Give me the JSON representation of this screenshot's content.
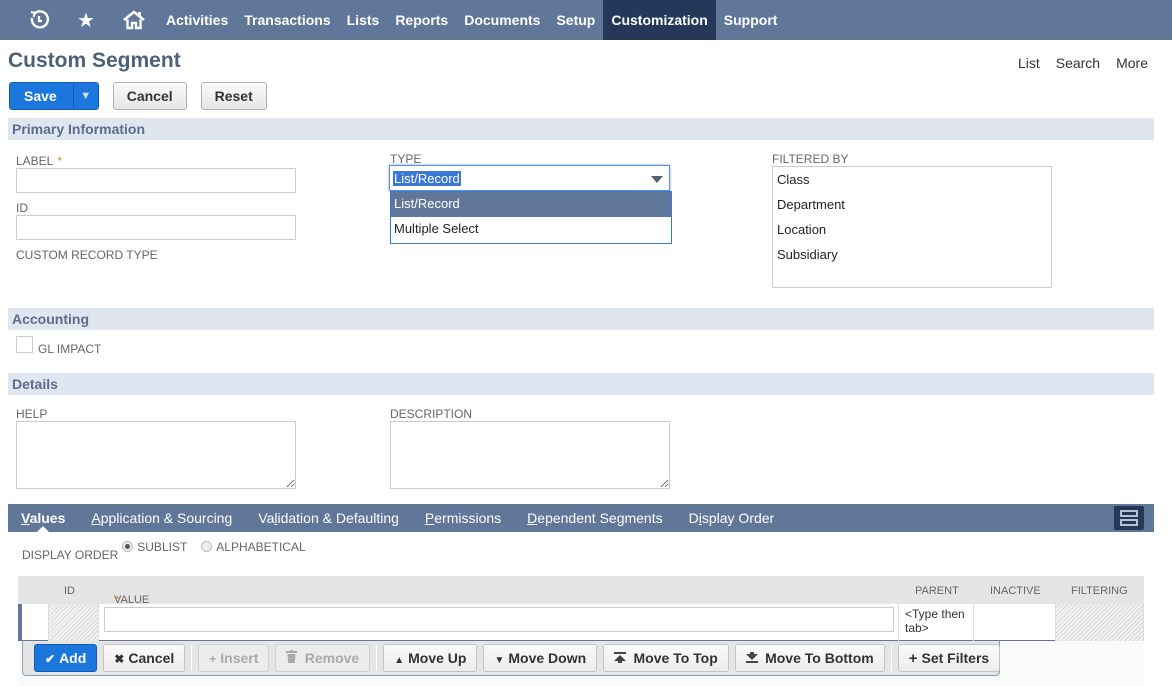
{
  "nav": {
    "icons": [
      "recent-icon",
      "star-icon",
      "home-icon"
    ],
    "items": [
      "Activities",
      "Transactions",
      "Lists",
      "Reports",
      "Documents",
      "Setup",
      "Customization",
      "Support"
    ],
    "active": "Customization"
  },
  "page": {
    "title": "Custom Segment",
    "links": [
      "List",
      "Search",
      "More"
    ]
  },
  "actions": {
    "save": "Save",
    "cancel": "Cancel",
    "reset": "Reset"
  },
  "primary": {
    "header": "Primary Information",
    "label_label": "LABEL",
    "label_required": "*",
    "label_value": "",
    "id_label": "ID",
    "id_value": "",
    "custom_record_type_label": "CUSTOM RECORD TYPE",
    "type_label": "TYPE",
    "type_value": "List/Record",
    "type_options": [
      "List/Record",
      "Multiple Select"
    ],
    "filtered_by_label": "FILTERED BY",
    "filtered_by_options": [
      "Class",
      "Department",
      "Location",
      "Subsidiary"
    ]
  },
  "accounting": {
    "header": "Accounting",
    "gl_impact_label": "GL IMPACT",
    "gl_impact_checked": false
  },
  "details": {
    "header": "Details",
    "help_label": "HELP",
    "help_value": "",
    "description_label": "DESCRIPTION",
    "description_value": ""
  },
  "subtabs": {
    "items": [
      {
        "label": "Values",
        "accesskey_index": 0
      },
      {
        "label": "Application & Sourcing",
        "accesskey_index": 0
      },
      {
        "label": "Validation & Defaulting",
        "accesskey_index": 2
      },
      {
        "label": "Permissions",
        "accesskey_index": 0
      },
      {
        "label": "Dependent Segments",
        "accesskey_index": 0
      },
      {
        "label": "Display Order",
        "accesskey_index": 1
      }
    ],
    "active": "Values"
  },
  "display_order": {
    "label": "DISPLAY ORDER",
    "options": [
      "SUBLIST",
      "ALPHABETICAL"
    ],
    "selected": "SUBLIST"
  },
  "values_table": {
    "columns": [
      "ID",
      "VALUE",
      "PARENT",
      "INACTIVE",
      "FILTERING"
    ],
    "value_required": "*",
    "parent_placeholder": "<Type then tab>",
    "buttons": [
      {
        "label": "Add",
        "glyph": "✔",
        "state": "primary"
      },
      {
        "label": "Cancel",
        "glyph": "✖",
        "state": "normal"
      },
      {
        "label": "Insert",
        "glyph": "+",
        "state": "disabled"
      },
      {
        "label": "Remove",
        "glyph": "🗑",
        "state": "disabled"
      },
      {
        "label": "Move Up",
        "glyph": "▲",
        "state": "normal"
      },
      {
        "label": "Move Down",
        "glyph": "▼",
        "state": "normal"
      },
      {
        "label": "Move To Top",
        "glyph": "⤒",
        "state": "normal"
      },
      {
        "label": "Move To Bottom",
        "glyph": "⤓",
        "state": "normal"
      },
      {
        "label": "Set Filters",
        "glyph": "+",
        "state": "normal"
      }
    ]
  }
}
